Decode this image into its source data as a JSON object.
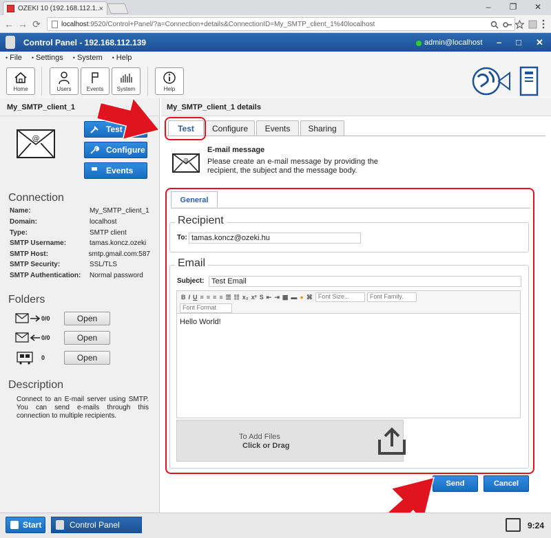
{
  "browser": {
    "tab_title": "OZEKI 10 (192.168.112.1...",
    "tab_close": "×",
    "url_host": "localhost",
    "url_rest": ":9520/Control+Panel/?a=Connection+details&ConnectionID=My_SMTP_client_1%40localhost",
    "minimize": "–",
    "maximize": "❐",
    "close": "✕",
    "back": "←",
    "forward": "→",
    "reload": "⟳"
  },
  "app": {
    "title": "Control Panel - 192.168.112.139",
    "user": "admin@localhost",
    "minimize": "–",
    "maximize": "□",
    "close": "✕"
  },
  "menu": [
    "File",
    "Settings",
    "System",
    "Help"
  ],
  "toolbar": {
    "home": "Home",
    "users": "Users",
    "events": "Events",
    "system": "System",
    "help": "Help"
  },
  "left": {
    "title": "My_SMTP_client_1",
    "buttons": {
      "test": "Test",
      "configure": "Configure",
      "events": "Events"
    },
    "connection_heading": "Connection",
    "connection": [
      {
        "k": "Name:",
        "v": "My_SMTP_client_1"
      },
      {
        "k": "Domain:",
        "v": "localhost"
      },
      {
        "k": "Type:",
        "v": "SMTP client"
      },
      {
        "k": "SMTP Username:",
        "v": "tamas.koncz.ozeki"
      },
      {
        "k": "SMTP Host:",
        "v": "smtp.gmail.com:587"
      },
      {
        "k": "SMTP Security:",
        "v": "SSL/TLS"
      },
      {
        "k": "SMTP Authentication:",
        "v": "Normal password"
      }
    ],
    "folders_heading": "Folders",
    "folders": [
      {
        "count": "0/0",
        "button": "Open"
      },
      {
        "count": "0/0",
        "button": "Open"
      },
      {
        "count": "0",
        "button": "Open"
      }
    ],
    "description_heading": "Description",
    "description": "Connect to an E-mail server using SMTP. You can send e-mails through this connection to multiple recipients."
  },
  "right": {
    "title": "My_SMTP_client_1 details",
    "tabs": [
      "Test",
      "Configure",
      "Events",
      "Sharing"
    ],
    "msg_title": "E-mail message",
    "msg_desc": "Please create an e-mail message by providing the recipient, the subject and the message body.",
    "general_tab": "General",
    "recipient_legend": "Recipient",
    "to_label": "To:",
    "to_value": "tamas.koncz@ozeki.hu",
    "email_legend": "Email",
    "subject_label": "Subject:",
    "subject_value": "Test Email",
    "editor": {
      "font_size": "Font Size...",
      "font_family": "Font Family.",
      "font_format": "Font Format",
      "body": "Hello World!"
    },
    "drop_line1": "To Add Files",
    "drop_line2": "Click or Drag",
    "send": "Send",
    "cancel": "Cancel"
  },
  "taskbar": {
    "start": "Start",
    "control_panel": "Control Panel",
    "clock": "9:24"
  },
  "colors": {
    "accent": "#1a6dc0",
    "highlight": "#e0141e"
  }
}
